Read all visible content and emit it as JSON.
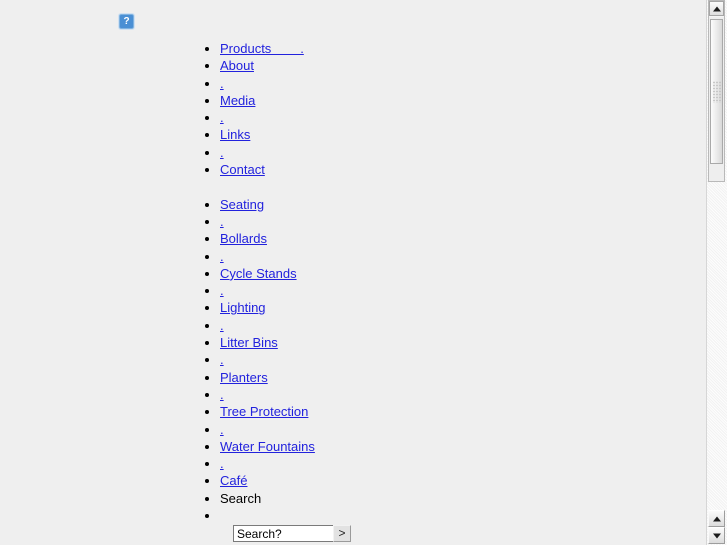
{
  "page": {
    "background_color": "#efefef",
    "link_color": "#2222dd",
    "text_color": "#000000"
  },
  "broken_image": {
    "glyph": "?",
    "icon_name": "broken-image-placeholder"
  },
  "nav": {
    "items": [
      {
        "label": "Products        .",
        "type": "link"
      },
      {
        "label": "About",
        "type": "link"
      },
      {
        "label": ".",
        "type": "link"
      },
      {
        "label": "Media",
        "type": "link"
      },
      {
        "label": ".",
        "type": "link"
      },
      {
        "label": "Links",
        "type": "link"
      },
      {
        "label": ".",
        "type": "link"
      },
      {
        "label": "Contact",
        "type": "link"
      },
      {
        "label": "",
        "type": "spacer"
      },
      {
        "label": "Seating",
        "type": "link"
      },
      {
        "label": ".",
        "type": "link"
      },
      {
        "label": "Bollards",
        "type": "link"
      },
      {
        "label": ".",
        "type": "link"
      },
      {
        "label": "Cycle Stands",
        "type": "link"
      },
      {
        "label": ".",
        "type": "link"
      },
      {
        "label": "Lighting",
        "type": "link"
      },
      {
        "label": ".",
        "type": "link"
      },
      {
        "label": "Litter Bins",
        "type": "link"
      },
      {
        "label": ".",
        "type": "link"
      },
      {
        "label": "Planters",
        "type": "link"
      },
      {
        "label": ".",
        "type": "link"
      },
      {
        "label": "Tree Protection",
        "type": "link"
      },
      {
        "label": ".",
        "type": "link"
      },
      {
        "label": "Water Fountains",
        "type": "link"
      },
      {
        "label": ".",
        "type": "link"
      },
      {
        "label": "Café",
        "type": "link"
      },
      {
        "label": "Search",
        "type": "text"
      },
      {
        "label": "",
        "type": "empty"
      }
    ]
  },
  "search": {
    "value": "Search?",
    "placeholder": "Search?",
    "submit_label": ">"
  },
  "scrollbars": {
    "outer": {
      "up_icon": "scroll-up-icon",
      "down_icon": "scroll-down-icon"
    },
    "inner": {
      "up_icon": "scroll-up-icon"
    }
  }
}
